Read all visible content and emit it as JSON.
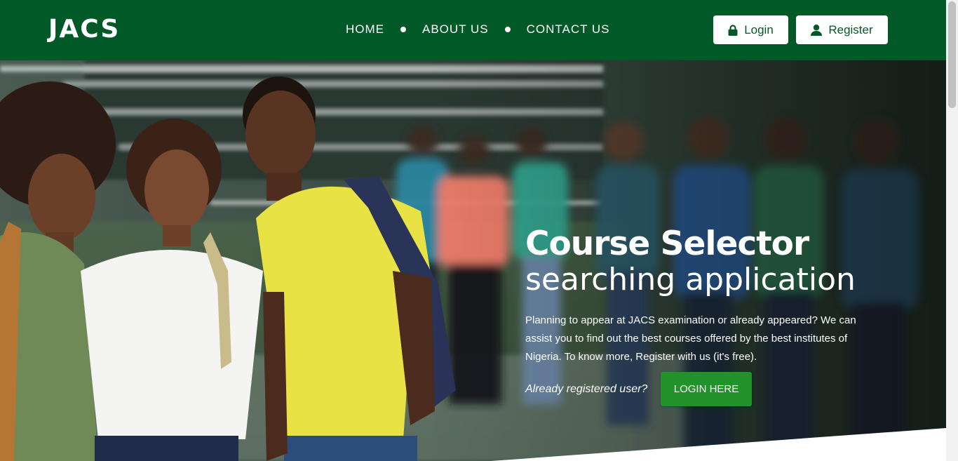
{
  "brand": {
    "logo": "JACS",
    "primary_color": "#025928",
    "accent_color": "#22922b"
  },
  "nav": {
    "items": [
      {
        "label": "HOME"
      },
      {
        "label": "ABOUT US"
      },
      {
        "label": "CONTACT US"
      }
    ]
  },
  "header_buttons": {
    "login": {
      "label": "Login",
      "icon": "lock-icon"
    },
    "register": {
      "label": "Register",
      "icon": "user-icon"
    }
  },
  "hero": {
    "title_line1": "Course Selector",
    "title_line2": "searching application",
    "description": "Planning to appear at JACS examination or already appeared? We can assist you to find out the best courses offered by the best institutes of Nigeria. To know more, Register with us (it's free).",
    "question": "Already registered user?",
    "cta": "LOGIN HERE",
    "image": "group of smiling students with backpacks on campus"
  }
}
